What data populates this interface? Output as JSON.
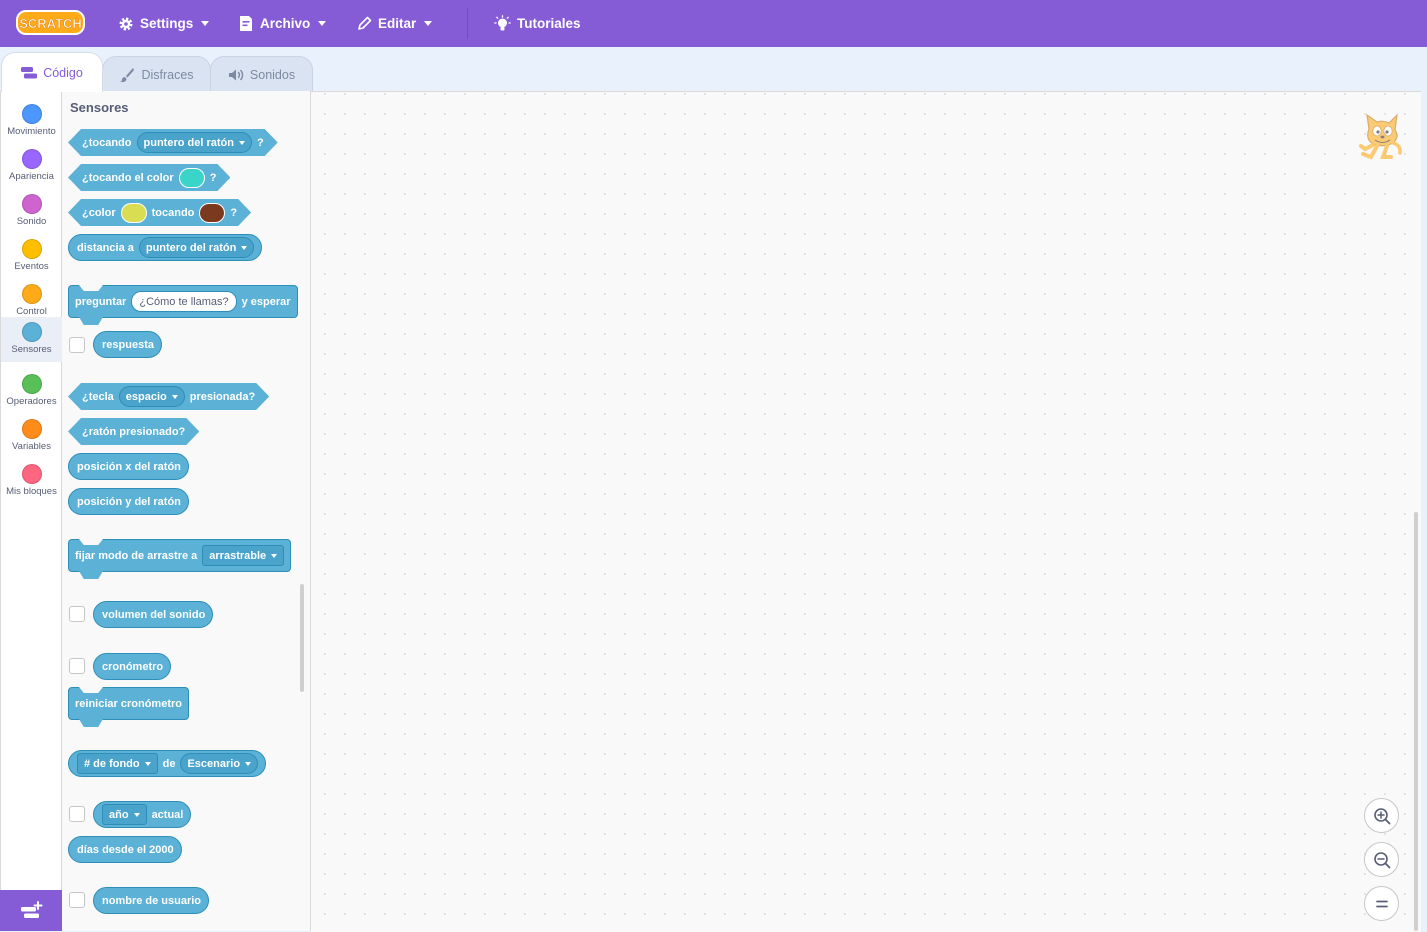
{
  "menubar": {
    "logo_text": "SCRATCH",
    "settings": "Settings",
    "file": "Archivo",
    "edit": "Editar",
    "tutorials": "Tutoriales"
  },
  "tabs": {
    "code": "Código",
    "costumes": "Disfraces",
    "sounds": "Sonidos"
  },
  "categories": [
    {
      "label": "Movimiento",
      "color": "#4c97ff"
    },
    {
      "label": "Apariencia",
      "color": "#9966ff"
    },
    {
      "label": "Sonido",
      "color": "#cf63cf"
    },
    {
      "label": "Eventos",
      "color": "#ffbf00"
    },
    {
      "label": "Control",
      "color": "#ffab19"
    },
    {
      "label": "Sensores",
      "color": "#5cb1d6"
    },
    {
      "label": "Operadores",
      "color": "#59c059"
    },
    {
      "label": "Variables",
      "color": "#ff8c1a"
    },
    {
      "label": "Mis bloques",
      "color": "#ff6680"
    }
  ],
  "selected_category": "Sensores",
  "palette": {
    "title": "Sensores",
    "touching": {
      "label": "¿tocando",
      "menu": "puntero del ratón",
      "end": "?"
    },
    "touching_color": {
      "label": "¿tocando el color",
      "swatch": "#3ad4c9",
      "end": "?"
    },
    "color_touching": {
      "label": "¿color",
      "swatch1": "#d8dd52",
      "mid": "tocando",
      "swatch2": "#7b3a20",
      "end": "?"
    },
    "distance": {
      "label": "distancia a",
      "menu": "puntero del ratón"
    },
    "ask": {
      "label": "preguntar",
      "input": "¿Cómo te llamas?",
      "end": "y esperar"
    },
    "answer": "respuesta",
    "key_pressed": {
      "label": "¿tecla",
      "menu": "espacio",
      "end": "presionada?"
    },
    "mouse_down": "¿ratón presionado?",
    "mouse_x": "posición x del ratón",
    "mouse_y": "posición y del ratón",
    "drag_mode": {
      "label": "fijar modo de arrastre a",
      "menu": "arrastrable"
    },
    "loudness": "volumen del sonido",
    "timer": "cronómetro",
    "reset_timer": "reiniciar cronómetro",
    "of": {
      "menu1": "# de fondo",
      "mid": "de",
      "menu2": "Escenario"
    },
    "current": {
      "menu": "año",
      "end": "actual"
    },
    "days_since": "días desde el 2000",
    "username": "nombre de usuario"
  },
  "colors": {
    "menubar": "#855cd6",
    "sensing": "#5cb1d6",
    "sensing_border": "#2e8eb8"
  }
}
